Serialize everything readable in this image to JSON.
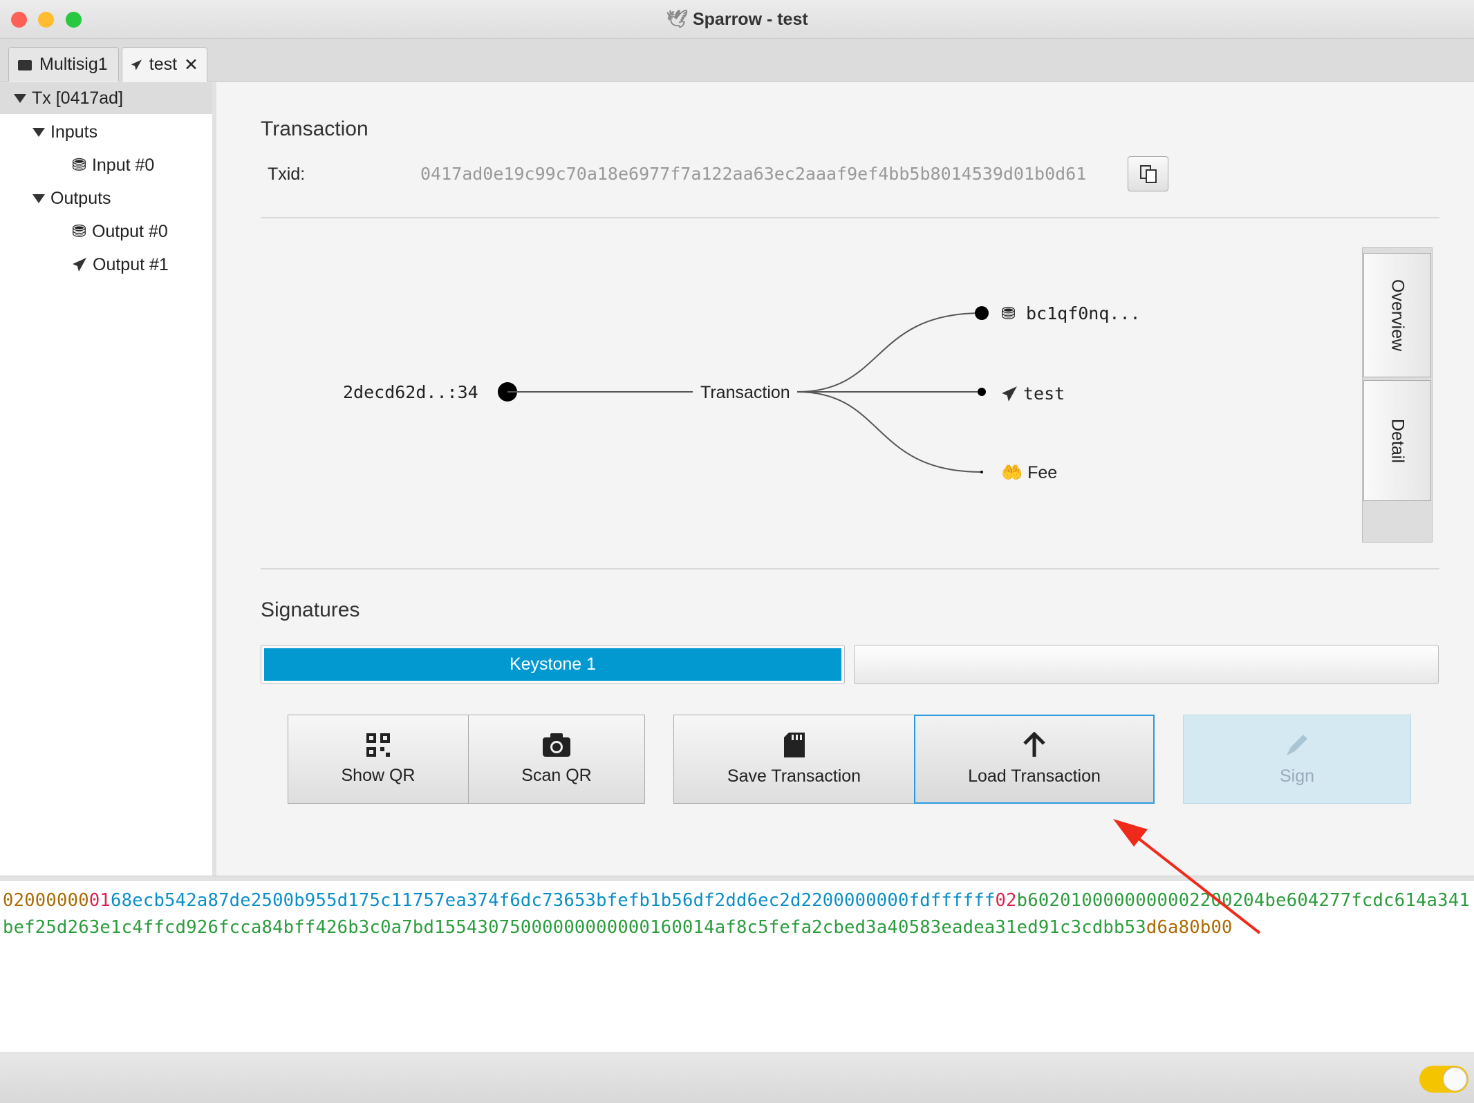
{
  "window": {
    "title": "Sparrow - test"
  },
  "tabs": [
    {
      "label": "Multisig1",
      "icon": "wallet-icon"
    },
    {
      "label": "test",
      "icon": "send-icon",
      "closable": true
    }
  ],
  "tree": {
    "root": "Tx [0417ad]",
    "inputs": "Inputs",
    "input_items": [
      "Input #0"
    ],
    "outputs": "Outputs",
    "output_items": [
      "Output #0",
      "Output #1"
    ]
  },
  "transaction": {
    "heading": "Transaction",
    "txid_label": "Txid:",
    "txid": "0417ad0e19c99c70a18e6977f7a122aa63ec2aaaf9ef4bb5b8014539d01b0d61"
  },
  "diagram": {
    "input": "2decd62d..:34",
    "center": "Transaction",
    "outputs": [
      {
        "label": "bc1qf0nq...",
        "icon": "coins-icon"
      },
      {
        "label": "test",
        "icon": "send-icon"
      },
      {
        "label": "Fee",
        "icon": "hand-icon"
      }
    ]
  },
  "side_tabs": [
    "Overview",
    "Detail"
  ],
  "signatures": {
    "heading": "Signatures",
    "signers": [
      "Keystone 1",
      ""
    ],
    "progress": 0.5,
    "accent": "#0299d1"
  },
  "buttons": {
    "show_qr": "Show QR",
    "scan_qr": "Scan QR",
    "save": "Save Transaction",
    "load": "Load Transaction",
    "sign": "Sign"
  },
  "hex": [
    {
      "text": "02000000",
      "color": "#a96a00"
    },
    {
      "text": "01",
      "color": "#e0204c"
    },
    {
      "text": "68ecb542a87de2500b955d175c11757ea374f6dc73653bfefb1b56df2dd6ec2d2200000000fdffffff",
      "color": "#0a8ec8"
    },
    {
      "text": "02",
      "color": "#e0204c"
    },
    {
      "text": "b6020100000000002200204be604277fcdc614a341bef25d263e1c4ffcd926fcca84bff426b3c0a7bd15543075000000000000160014af8c5fefa2cbed3a40583eadea31ed91c3cdbb53",
      "color": "#2a9c3c"
    },
    {
      "text": "d6a80b00",
      "color": "#a96a00"
    }
  ]
}
